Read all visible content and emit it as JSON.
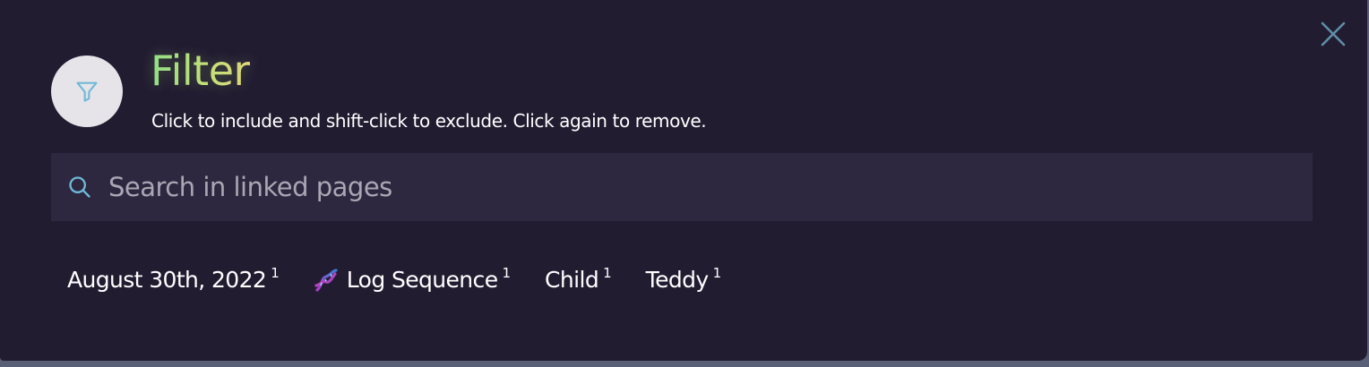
{
  "header": {
    "title": "Filter",
    "subtitle": "Click to include and shift-click to exclude. Click again to remove."
  },
  "search": {
    "placeholder": "Search in linked pages"
  },
  "icons": {
    "filter": "filter-funnel-icon",
    "search": "search-icon",
    "close": "close-icon",
    "emoji": "dna-emoji-icon"
  },
  "colors": {
    "panel_bg": "#221c31",
    "search_bg": "#2d283f",
    "accent_icon": "#6fb9d8",
    "title_gradient_start": "#8fdf88",
    "title_gradient_end": "#e2d77a"
  },
  "filters": [
    {
      "label": "August 30th, 2022",
      "count": "1",
      "emoji": ""
    },
    {
      "label": "Log Sequence",
      "count": "1",
      "emoji": "dna"
    },
    {
      "label": "Child",
      "count": "1",
      "emoji": ""
    },
    {
      "label": "Teddy",
      "count": "1",
      "emoji": ""
    }
  ]
}
